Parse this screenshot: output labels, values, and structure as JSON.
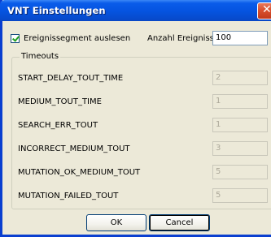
{
  "window": {
    "title": "VNT Einstellungen"
  },
  "options": {
    "read_segment_label": "Ereignissegment auslesen",
    "read_segment_checked": true,
    "event_count_label": "Anzahl Ereignisse",
    "event_count_value": "100"
  },
  "timeouts": {
    "group_label": "Timeouts",
    "rows": [
      {
        "label": "START_DELAY_TOUT_TIME",
        "value": "2"
      },
      {
        "label": "MEDIUM_TOUT_TIME",
        "value": "1"
      },
      {
        "label": "SEARCH_ERR_TOUT",
        "value": "1"
      },
      {
        "label": "INCORRECT_MEDIUM_TOUT",
        "value": "3"
      },
      {
        "label": "MUTATION_OK_MEDIUM_TOUT",
        "value": "5"
      },
      {
        "label": "MUTATION_FAILED_TOUT",
        "value": "5"
      }
    ]
  },
  "buttons": {
    "ok_label": "OK",
    "cancel_label": "Cancel"
  }
}
